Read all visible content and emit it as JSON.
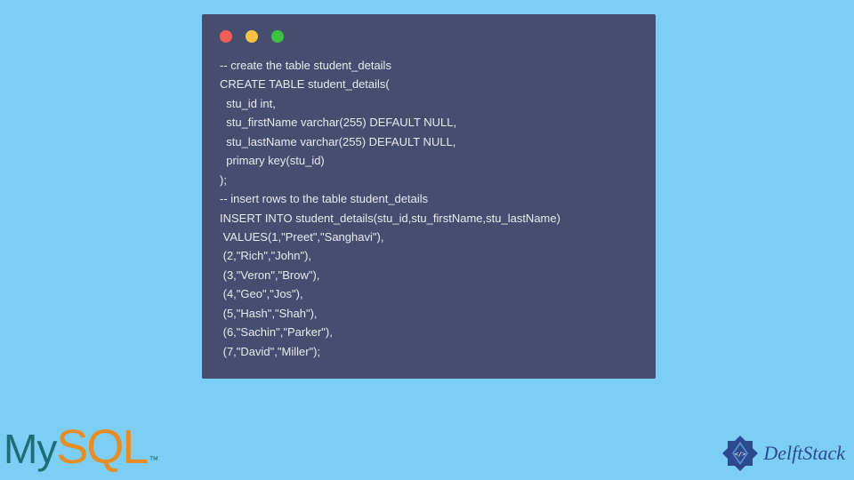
{
  "code": {
    "lines": [
      "-- create the table student_details",
      "CREATE TABLE student_details(",
      "  stu_id int,",
      "  stu_firstName varchar(255) DEFAULT NULL,",
      "  stu_lastName varchar(255) DEFAULT NULL,",
      "  primary key(stu_id)",
      ");",
      "-- insert rows to the table student_details",
      "INSERT INTO student_details(stu_id,stu_firstName,stu_lastName)",
      " VALUES(1,\"Preet\",\"Sanghavi\"),",
      " (2,\"Rich\",\"John\"),",
      " (3,\"Veron\",\"Brow\"),",
      " (4,\"Geo\",\"Jos\"),",
      " (5,\"Hash\",\"Shah\"),",
      " (6,\"Sachin\",\"Parker\"),",
      " (7,\"David\",\"Miller\");"
    ]
  },
  "logos": {
    "mysql": {
      "part1": "My",
      "part2": "SQL",
      "tm": "™"
    },
    "delftstack": {
      "text": "DelftStack"
    }
  }
}
